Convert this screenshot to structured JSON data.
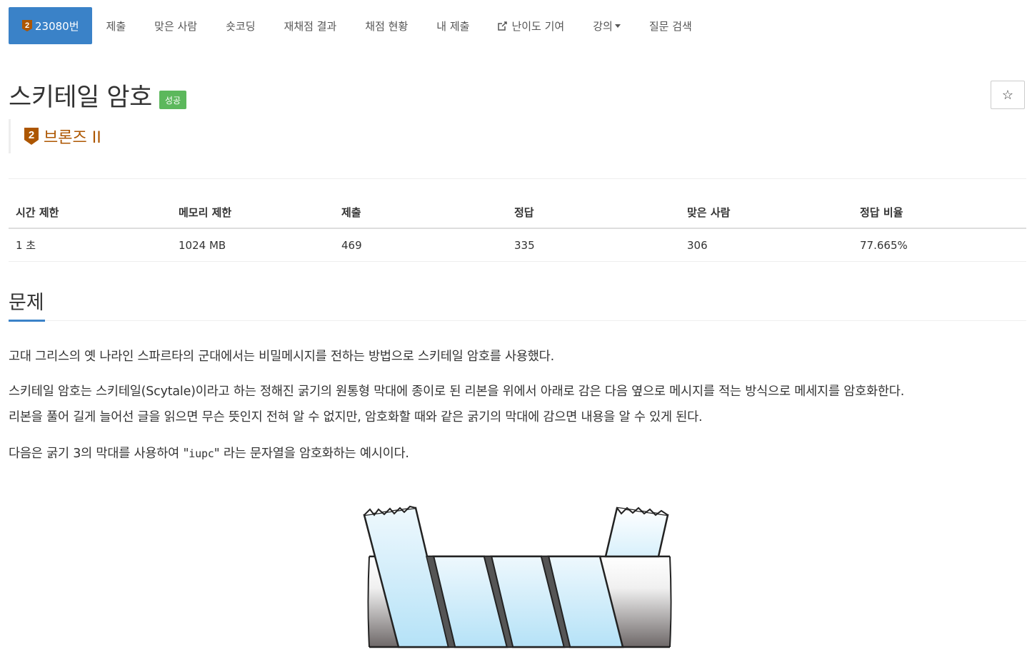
{
  "nav": {
    "problem_number": "23080번",
    "tabs": [
      "제출",
      "맞은 사람",
      "숏코딩",
      "재채점 결과",
      "채점 현황",
      "내 제출"
    ],
    "contribute": "난이도 기여",
    "lecture": "강의",
    "question_search": "질문 검색"
  },
  "problem": {
    "title": "스키테일 암호",
    "status_badge": "성공",
    "tier_number": "2",
    "tier_text": "브론즈 II",
    "star_icon": "☆"
  },
  "info_table": {
    "headers": [
      "시간 제한",
      "메모리 제한",
      "제출",
      "정답",
      "맞은 사람",
      "정답 비율"
    ],
    "values": [
      "1 초",
      "1024 MB",
      "469",
      "335",
      "306",
      "77.665%"
    ]
  },
  "section": {
    "heading": "문제",
    "p1": "고대 그리스의 옛 나라인 스파르타의 군대에서는 비밀메시지를 전하는 방법으로 스키테일 암호를 사용했다.",
    "p2_line1": "스키테일 암호는 스키테일(Scytale)이라고 하는 정해진 굵기의 원통형 막대에 종이로 된 리본을 위에서 아래로 감은 다음 옆으로 메시지를 적는 방식으로 메세지를 암호화한다.",
    "p2_line2": "리본을 풀어 길게 늘어선 글을 읽으면 무슨 뜻인지 전혀 알 수 없지만, 암호화할 때와 같은 굵기의 막대에 감으면 내용을 알 수 있게 된다.",
    "p3_before": "다음은 굵기 3의 막대를 사용하여 \"",
    "p3_code": "iupc",
    "p3_after": "\" 라는 문자열을 암호화하는 예시이다."
  },
  "colors": {
    "accent": "#3a82c8",
    "success": "#5cb85c",
    "bronze": "#ad5600"
  }
}
